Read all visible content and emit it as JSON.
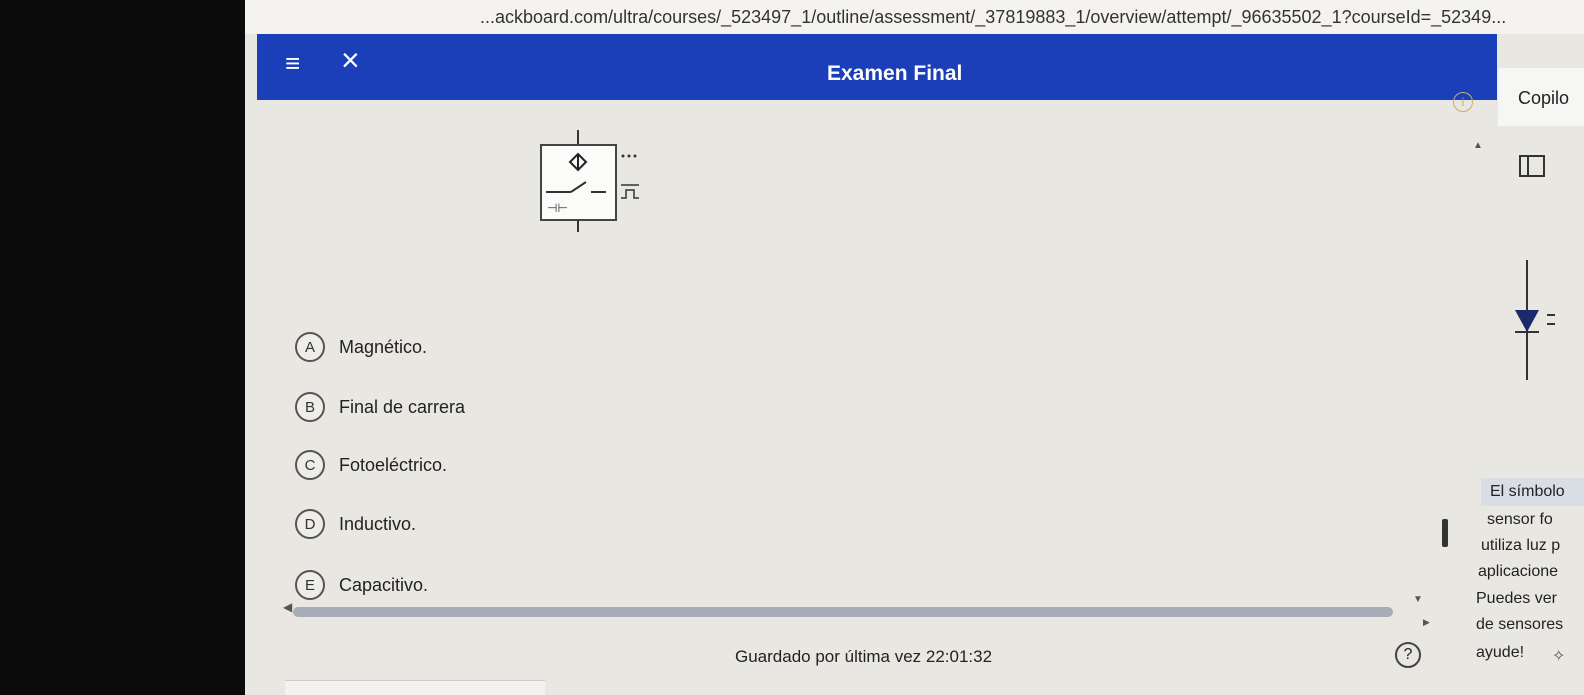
{
  "browser": {
    "url": "...ackboard.com/ultra/courses/_523497_1/outline/assessment/_37819883_1/overview/attempt/_96635502_1?courseId=_52349..."
  },
  "header": {
    "title": "Examen Final",
    "menu_icon": "hamburger-icon",
    "close_icon": "close-icon",
    "accent_color": "#1a3fb8"
  },
  "copilot": {
    "label": "Copilo",
    "lines": [
      "El símbolo",
      "sensor fo",
      "utiliza luz p",
      "aplicacione",
      "Puedes ver",
      "de sensores",
      "ayude! "
    ]
  },
  "question": {
    "options": [
      {
        "letter": "A",
        "text": "Magnético."
      },
      {
        "letter": "B",
        "text": "Final de carrera"
      },
      {
        "letter": "C",
        "text": "Fotoeléctrico."
      },
      {
        "letter": "D",
        "text": "Inductivo."
      },
      {
        "letter": "E",
        "text": "Capacitivo."
      }
    ]
  },
  "footer": {
    "saved_text": "Guardado por última vez 22:01:32",
    "help_symbol": "?"
  }
}
